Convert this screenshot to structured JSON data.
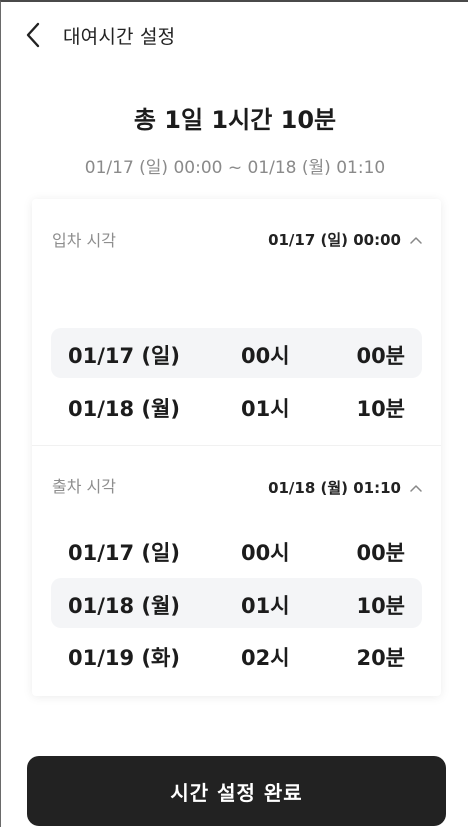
{
  "header": {
    "title": "대여시간 설정",
    "back_icon": "chevron-left-icon"
  },
  "summary": {
    "total": "총 1일 1시간 10분",
    "range": "01/17 (일) 00:00 ~ 01/18 (월) 01:10"
  },
  "pickup": {
    "label": "입차 시각",
    "value": "01/17 (일) 00:00",
    "rows": [
      {
        "date": "01/17 (일)",
        "hour": "00시",
        "minute": "00분",
        "selected": true
      },
      {
        "date": "01/18 (월)",
        "hour": "01시",
        "minute": "10분",
        "selected": false
      }
    ]
  },
  "return": {
    "label": "출차 시각",
    "value": "01/18 (월) 01:10",
    "rows": [
      {
        "date": "01/17 (일)",
        "hour": "00시",
        "minute": "00분",
        "selected": false
      },
      {
        "date": "01/18 (월)",
        "hour": "01시",
        "minute": "10분",
        "selected": true
      },
      {
        "date": "01/19 (화)",
        "hour": "02시",
        "minute": "20분",
        "selected": false
      }
    ]
  },
  "confirm_button": {
    "label": "시간 설정 완료"
  },
  "colors": {
    "button_bg": "#222222",
    "selected_row_bg": "#f4f5f7",
    "muted_text": "#8a8a8a"
  }
}
